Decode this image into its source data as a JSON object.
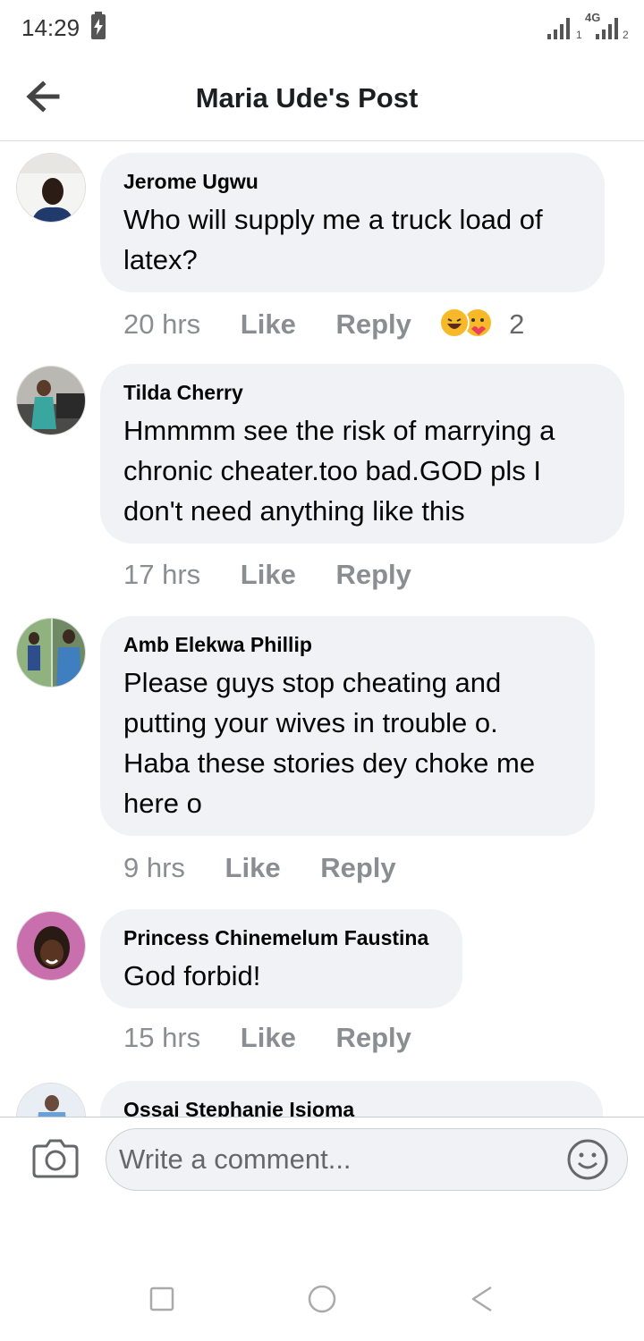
{
  "status_bar": {
    "time": "14:29",
    "sim1_label": "1",
    "sim2_label": "2",
    "network_label": "4G"
  },
  "header": {
    "title": "Maria Ude's Post",
    "back_icon": "arrow-left-icon"
  },
  "comments": [
    {
      "author": "Jerome Ugwu",
      "text": "Who will supply me a truck load of latex?",
      "time": "20 hrs",
      "like_label": "Like",
      "reply_label": "Reply",
      "reactions": [
        "haha",
        "care"
      ],
      "reaction_count": "2"
    },
    {
      "author": "Tilda Cherry",
      "text": "Hmmmm see the risk of marrying a chronic cheater.too bad.GOD pls I don't need anything like this",
      "time": "17 hrs",
      "like_label": "Like",
      "reply_label": "Reply"
    },
    {
      "author": "Amb Elekwa Phillip",
      "text": "Please guys stop cheating and putting your wives in trouble o. Haba these stories dey choke me here o",
      "time": "9 hrs",
      "like_label": "Like",
      "reply_label": "Reply"
    },
    {
      "author": "Princess Chinemelum Faustina",
      "text": "God forbid!",
      "time": "15 hrs",
      "like_label": "Like",
      "reply_label": "Reply"
    },
    {
      "author": "Ossai Stephanie Isioma"
    }
  ],
  "composer": {
    "placeholder": "Write a comment...",
    "camera_icon": "camera-icon",
    "emoji_icon": "smiley-icon"
  },
  "nav": {
    "recents_icon": "square-icon",
    "home_icon": "circle-icon",
    "back_icon": "triangle-back-icon"
  },
  "colors": {
    "bubble": "#f0f2f5",
    "meta_text": "#8a8d91",
    "primary_text": "#050505",
    "divider": "#dadde1"
  }
}
